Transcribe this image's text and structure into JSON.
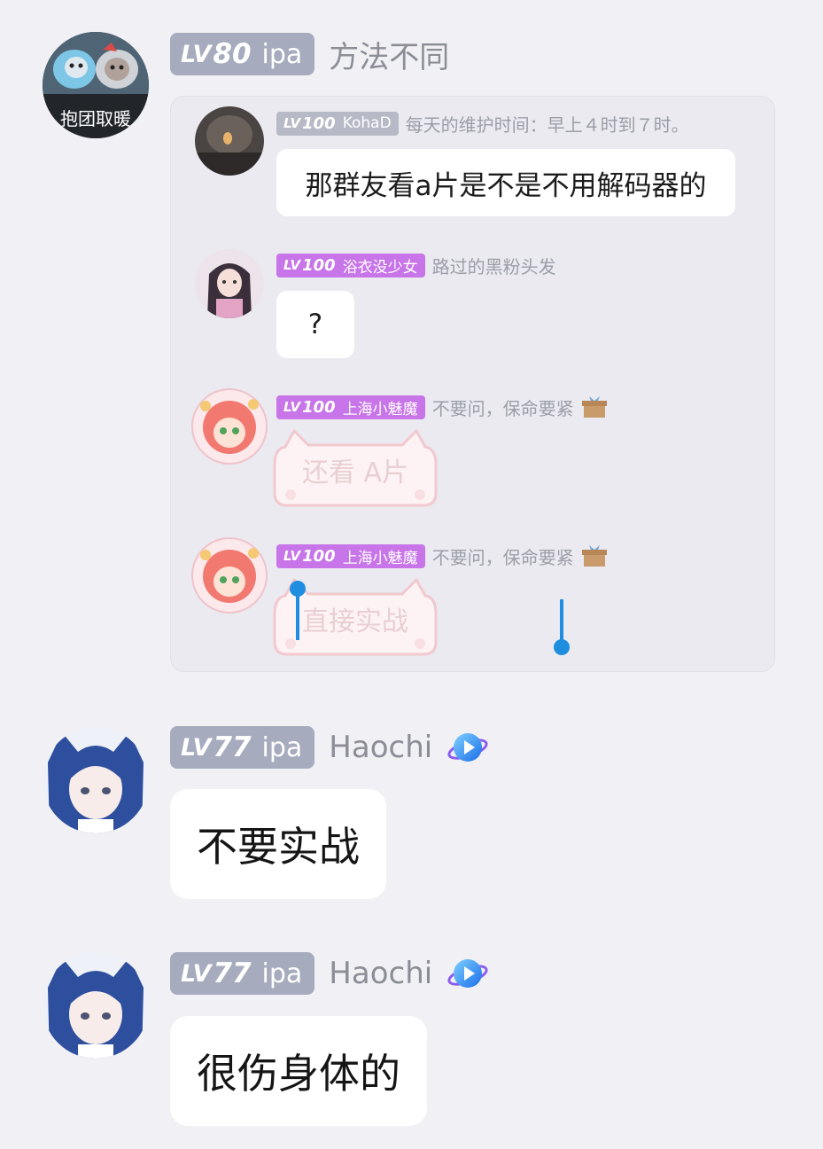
{
  "messages": [
    {
      "level_prefix": "LV",
      "level": "80",
      "group_title": "ipa",
      "nickname": "方法不同",
      "avatar_text": "抱团取暖",
      "quoted": [
        {
          "level_prefix": "LV",
          "level": "100",
          "title": "KohaD",
          "nickname": "每天的维护时间：早上４时到７时。",
          "text": "那群友看a片是不是不用解码器的"
        },
        {
          "level_prefix": "LV",
          "level": "100",
          "title": "浴衣没少女",
          "nickname": "路过的黑粉头发",
          "text": "?"
        },
        {
          "level_prefix": "LV",
          "level": "100",
          "title": "上海小魅魔",
          "nickname": "不要问，保命要紧",
          "sticker_text": "还看 A片"
        },
        {
          "level_prefix": "LV",
          "level": "100",
          "title": "上海小魅魔",
          "nickname": "不要问，保命要紧",
          "sticker_text": "直接实战"
        }
      ]
    },
    {
      "level_prefix": "LV",
      "level": "77",
      "group_title": "ipa",
      "nickname": "Haochi",
      "text": "不要实战"
    },
    {
      "level_prefix": "LV",
      "level": "77",
      "group_title": "ipa",
      "nickname": "Haochi",
      "text": "很伤身体的"
    }
  ],
  "colors": {
    "background": "#f1f1f5",
    "level_badge": "#a6abbd",
    "level_badge_top_tier": "#c775e8",
    "selection_handle": "#1f8ee0",
    "vip_icon": "#2b8ff0"
  }
}
